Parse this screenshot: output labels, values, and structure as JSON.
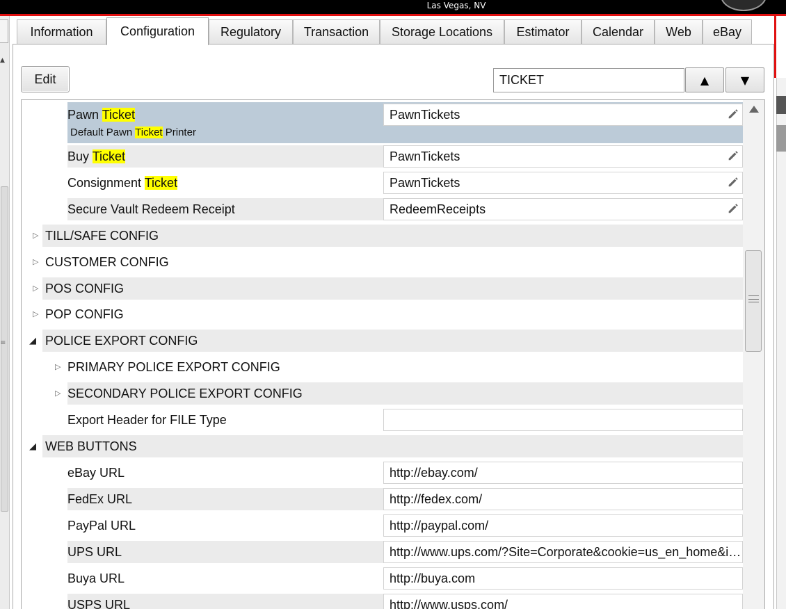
{
  "header": {
    "location": "Las Vegas, NV"
  },
  "tabs": [
    {
      "label": "Information"
    },
    {
      "label": "Configuration",
      "active": true
    },
    {
      "label": "Regulatory"
    },
    {
      "label": "Transaction"
    },
    {
      "label": "Storage Locations"
    },
    {
      "label": "Estimator"
    },
    {
      "label": "Calendar"
    },
    {
      "label": "Web"
    },
    {
      "label": "eBay"
    }
  ],
  "toolbar": {
    "edit_label": "Edit",
    "search_value": "TICKET",
    "prev_icon": "triangle-up-icon",
    "next_icon": "triangle-down-icon"
  },
  "search_term": "Ticket",
  "selected_row": {
    "label_prefix": "Pawn ",
    "label_match": "Ticket",
    "value": "PawnTickets",
    "description_prefix": "Default Pawn ",
    "description_match": "Ticket",
    "description_suffix": " Printer"
  },
  "rows": [
    {
      "kind": "setting",
      "label_prefix": "Buy ",
      "label_match": "Ticket",
      "value": "PawnTickets",
      "editable": true
    },
    {
      "kind": "setting",
      "label_prefix": "Consignment ",
      "label_match": "Ticket",
      "value": "PawnTickets",
      "editable": true
    },
    {
      "kind": "setting",
      "label": "Secure Vault Redeem Receipt",
      "value": "RedeemReceipts",
      "editable": true
    },
    {
      "kind": "group",
      "label": "TILL/SAFE CONFIG",
      "expanded": false
    },
    {
      "kind": "group",
      "label": "CUSTOMER CONFIG",
      "expanded": false
    },
    {
      "kind": "group",
      "label": "POS CONFIG",
      "expanded": false
    },
    {
      "kind": "group",
      "label": "POP CONFIG",
      "expanded": false
    },
    {
      "kind": "group",
      "label": "POLICE EXPORT CONFIG",
      "expanded": true
    },
    {
      "kind": "subgroup",
      "label": "PRIMARY POLICE EXPORT CONFIG",
      "expanded": false
    },
    {
      "kind": "subgroup",
      "label": "SECONDARY POLICE EXPORT CONFIG",
      "expanded": false
    },
    {
      "kind": "setting",
      "label": "Export Header for FILE Type",
      "value": ""
    },
    {
      "kind": "group",
      "label": "WEB BUTTONS",
      "expanded": true
    },
    {
      "kind": "setting",
      "label": "eBay URL",
      "value": "http://ebay.com/"
    },
    {
      "kind": "setting",
      "label": "FedEx URL",
      "value": "http://fedex.com/"
    },
    {
      "kind": "setting",
      "label": "PayPal URL",
      "value": "http://paypal.com/"
    },
    {
      "kind": "setting",
      "label": "UPS URL",
      "value": "http://www.ups.com/?Site=Corporate&cookie=us_en_home&inputImgTag=&setCookie=yes"
    },
    {
      "kind": "setting",
      "label": "Buya URL",
      "value": "http://buya.com"
    },
    {
      "kind": "setting",
      "label": "USPS URL",
      "value": "http://www.usps.com/"
    }
  ],
  "icons": {
    "edit": "pencil-icon",
    "collapsed": "triangle-right-icon",
    "expanded": "triangle-down-icon",
    "scroll_up": "scroll-up-arrow-icon"
  },
  "colors": {
    "selected_row": "#bccbd8",
    "highlight": "#ffff00",
    "alt_row": "#ebebeb",
    "accent_frame": "#e01010"
  }
}
